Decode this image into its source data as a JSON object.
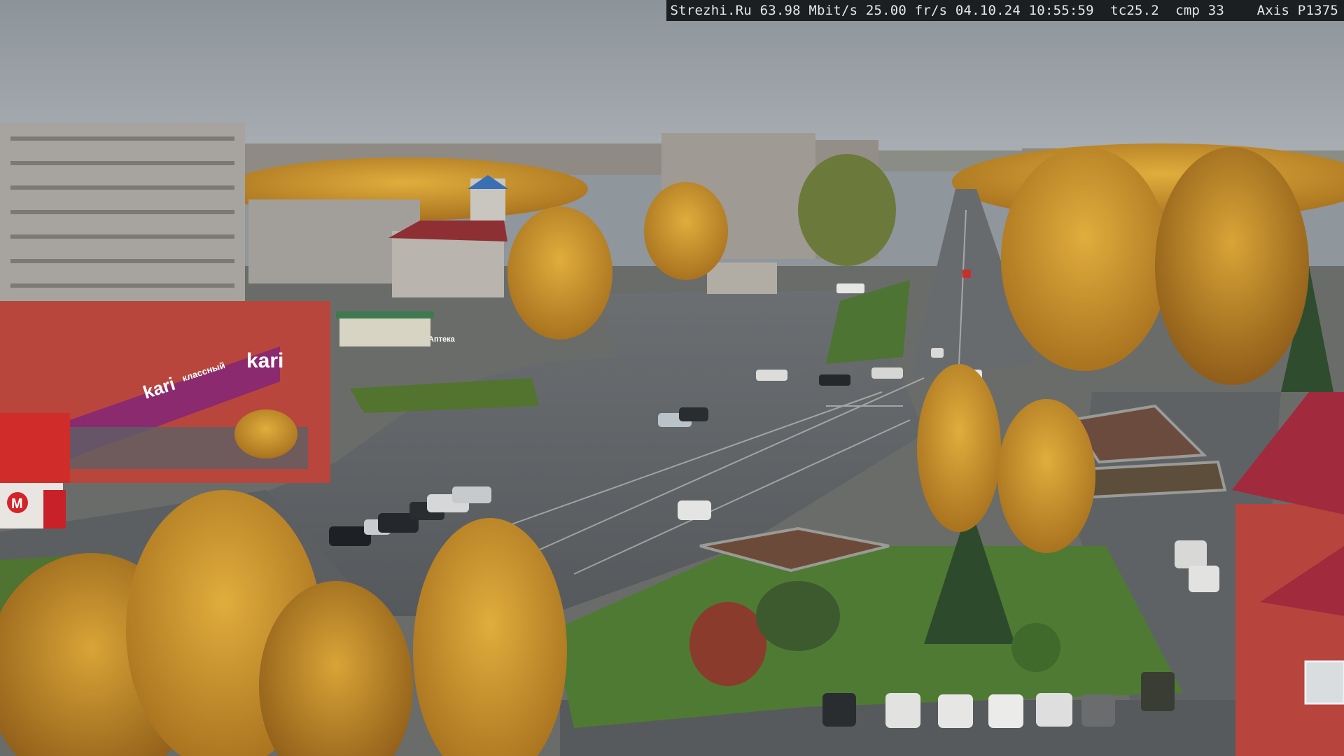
{
  "overlay": {
    "site": "Strezhi.Ru",
    "bitrate": "63.98 Mbit/s",
    "framerate": "25.00 fr/s",
    "date": "04.10.24",
    "time": "10:55:59",
    "tc": "tc25.2",
    "cmp": "cmp 33",
    "camera": "Axis P1375"
  },
  "signs": {
    "store_brand": "kari",
    "store_brand_2": "kari",
    "store_slogan": "классный",
    "grocery_logo": "M",
    "small_sign": "Аптека"
  },
  "colors": {
    "sky": "#9aa1a7",
    "asphalt": "#5a5e62",
    "foliage_gold": "#c9962b",
    "grass": "#4f7a33",
    "store_facade": "#b8463c",
    "store_banner": "#8b2a6e",
    "building_panel": "#a7a49f",
    "right_building": "#b8443e"
  }
}
